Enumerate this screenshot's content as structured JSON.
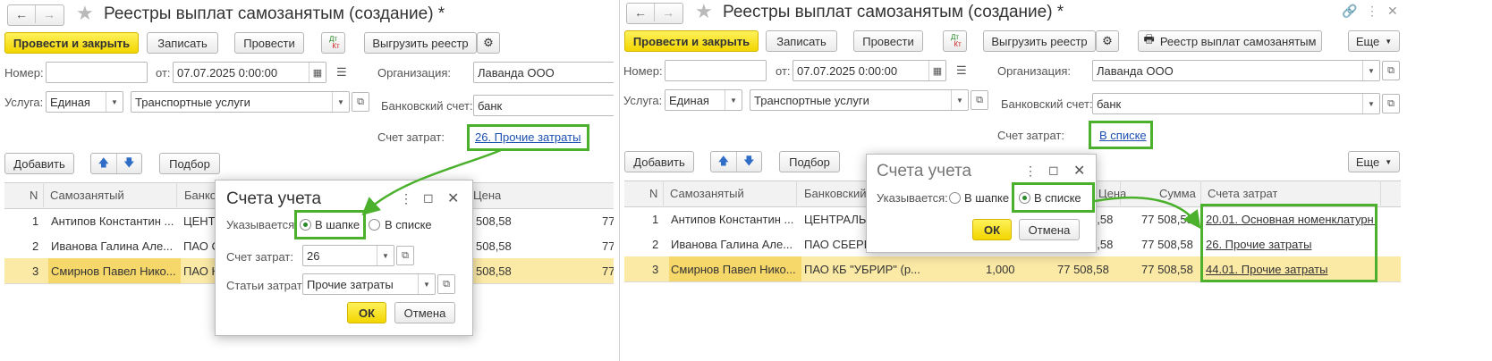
{
  "title": "Реестры выплат самозанятым (создание) *",
  "toolbar": {
    "post_close": "Провести и закрыть",
    "save": "Записать",
    "post": "Провести",
    "dt": "Дт",
    "kt": "Кт",
    "export": "Выгрузить реестр",
    "print_registry": "Реестр выплат самозанятым",
    "more": "Еще"
  },
  "form": {
    "number_label": "Номер:",
    "number_value": "",
    "date_label": "от:",
    "date_value": "07.07.2025  0:00:00",
    "org_label": "Организация:",
    "org_value": "Лаванда ООО",
    "service_label": "Услуга:",
    "service_type": "Единая",
    "service_value": "Транспортные услуги",
    "bank_label": "Банковский счет:",
    "bank_value": "банк",
    "cost_label": "Счет затрат:",
    "cost_left": "26. Прочие затраты",
    "cost_right": "В списке"
  },
  "table_toolbar": {
    "add": "Добавить",
    "pick": "Подбор",
    "more": "Еще"
  },
  "columns": {
    "n": "N",
    "self": "Самозанятый",
    "bank": "Банковский счет",
    "bank_short": "Банко",
    "price": "Цена",
    "sum": "Сумма",
    "accounts": "Счета затрат"
  },
  "rows_left": [
    {
      "n": "1",
      "name": "Антипов Константин ...",
      "bank": "ЦЕНТ",
      "price": "508,58",
      "sum": "77"
    },
    {
      "n": "2",
      "name": "Иванова Галина Але...",
      "bank": "ПАО С",
      "price": "508,58",
      "sum": "77"
    },
    {
      "n": "3",
      "name": "Смирнов Павел Нико...",
      "bank": "ПАО К",
      "price": "508,58",
      "sum": "77"
    }
  ],
  "rows_right": [
    {
      "n": "1",
      "name": "Антипов Константин ...",
      "bank": "ЦЕНТРАЛЬН",
      "qty": "",
      "price": "8,58",
      "sum": "77 508,58",
      "account": "20.01. Основная номенклатурн..."
    },
    {
      "n": "2",
      "name": "Иванова Галина Але...",
      "bank": "ПАО СБЕРЕ",
      "qty": "",
      "price": "8,58",
      "sum": "77 508,58",
      "account": "26. Прочие затраты"
    },
    {
      "n": "3",
      "name": "Смирнов Павел Нико...",
      "bank": "ПАО КБ \"УБРИР\" (р...",
      "qty": "1,000",
      "price": "77 508,58",
      "sum": "77 508,58",
      "account": "44.01. Прочие затраты"
    }
  ],
  "dialog": {
    "title": "Счета учета",
    "indicated_label": "Указывается:",
    "opt_header": "В шапке",
    "opt_list": "В списке",
    "cost_label": "Счет затрат:",
    "cost_value": "26",
    "items_label": "Статьи затрат:",
    "items_value": "Прочие затраты",
    "ok": "ОК",
    "cancel": "Отмена"
  },
  "colors": {
    "accent_green": "#4bb12d",
    "primary_yellow": "#f2d500",
    "selected_row": "#fbe9a6",
    "link_blue": "#1c4fb0"
  }
}
